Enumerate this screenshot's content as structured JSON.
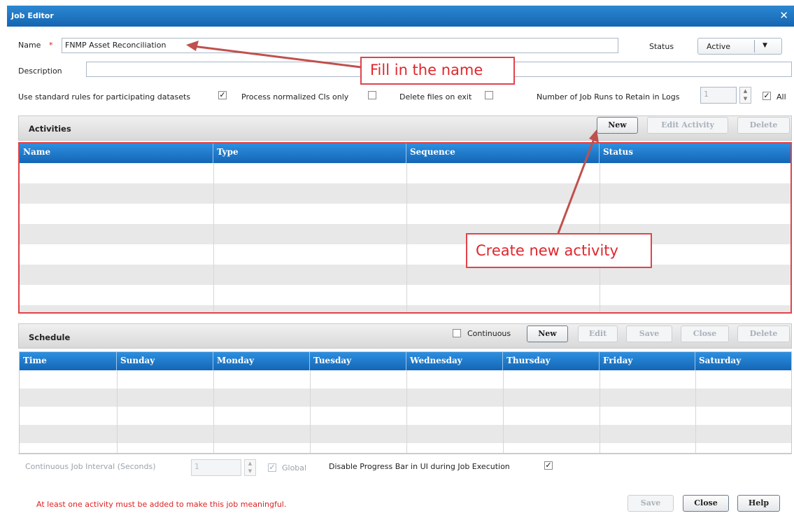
{
  "titlebar": {
    "title": "Job Editor",
    "close": "✕"
  },
  "form": {
    "name_label": "Name",
    "required_mark": "*",
    "name_value": "FNMP Asset Reconciliation",
    "status_label": "Status",
    "status_value": "Active",
    "description_label": "Description",
    "description_value": "",
    "std_rules_label": "Use standard rules for participating datasets",
    "process_norm_label": "Process normalized CIs only",
    "delete_files_label": "Delete files on exit",
    "job_runs_label": "Number of Job Runs to Retain in Logs",
    "job_runs_value": "1",
    "all_label": "All"
  },
  "activities": {
    "title": "Activities",
    "buttons": {
      "new": "New",
      "edit": "Edit Activity",
      "delete": "Delete"
    },
    "columns": [
      "Name",
      "Type",
      "Sequence",
      "Status"
    ]
  },
  "schedule": {
    "title": "Schedule",
    "continuous_label": "Continuous",
    "buttons": {
      "new": "New",
      "edit": "Edit",
      "save": "Save",
      "close": "Close",
      "delete": "Delete"
    },
    "columns": [
      "Time",
      "Sunday",
      "Monday",
      "Tuesday",
      "Wednesday",
      "Thursday",
      "Friday",
      "Saturday"
    ]
  },
  "bottom": {
    "interval_label": "Continuous Job Interval (Seconds)",
    "interval_value": "1",
    "global_label": "Global",
    "disable_progress_label": "Disable Progress Bar in UI during Job Execution",
    "warning": "At least one activity must be added to make this job meaningful.",
    "save": "Save",
    "close": "Close",
    "help": "Help"
  },
  "annotations": {
    "fill_name": "Fill in the name",
    "create_activity": "Create new activity"
  },
  "checkmark": "✓",
  "dropdown_arrow": "▼",
  "spin_up": "▲",
  "spin_down": "▼",
  "colors": {
    "titlebar": "#1a6fbf",
    "header": "#1b78cc",
    "callout": "#e0434a",
    "warning": "#e02020"
  }
}
